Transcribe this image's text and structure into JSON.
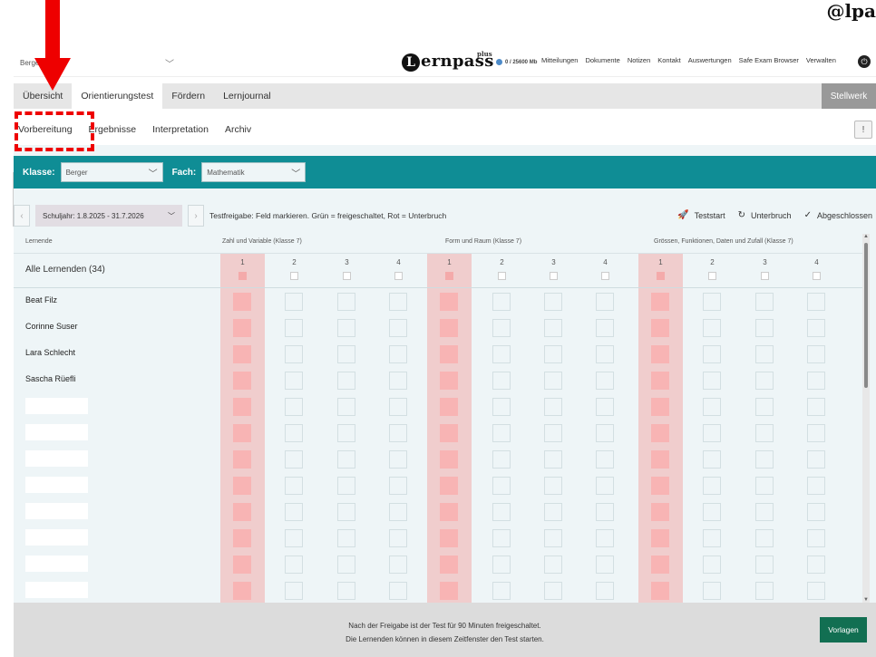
{
  "topbar": {
    "user_name": "Berger Judith",
    "logo": "Lernpass",
    "logo_plus": "plus",
    "storage": "0 / 25600 Mb",
    "nav": [
      "Mitteilungen",
      "Dokumente",
      "Notizen",
      "Kontakt",
      "Auswertungen",
      "Safe Exam Browser",
      "Verwalten"
    ]
  },
  "mainnav": {
    "tabs": [
      "Übersicht",
      "Orientierungstest",
      "Fördern",
      "Lernjournal"
    ],
    "active": "Orientierungstest",
    "right": "Stellwerk"
  },
  "subnav": {
    "tabs": [
      "Vorbereitung",
      "Ergebnisse",
      "Interpretation",
      "Archiv"
    ],
    "active": "Vorbereitung"
  },
  "filters": {
    "klasse_label": "Klasse:",
    "klasse_value": "Berger",
    "fach_label": "Fach:",
    "fach_value": "Mathematik"
  },
  "year": {
    "value": "Schuljahr: 1.8.2025 - 31.7.2026",
    "freigabe": "Testfreigabe: Feld markieren. Grün = freigeschaltet, Rot = Unterbruch",
    "actions": [
      "Teststart",
      "Unterbruch",
      "Abgeschlossen"
    ]
  },
  "table": {
    "col_lernende": "Lernende",
    "groups": [
      "Zahl und Variable (Klasse 7)",
      "Form und Raum (Klasse 7)",
      "Grössen, Funktionen, Daten und Zufall (Klasse 7)"
    ],
    "numbers": [
      "1",
      "2",
      "3",
      "4"
    ],
    "all_label": "Alle Lernenden (34)",
    "students": [
      "Beat Filz",
      "Corinne Suser",
      "Lara Schlecht",
      "Sascha Rüefli"
    ]
  },
  "footer": {
    "line1": "Nach der Freigabe ist der Test für 90 Minuten freigeschaltet.",
    "line2": "Die Lernenden können in diesem Zeitfenster den Test starten.",
    "button": "Vorlagen"
  }
}
